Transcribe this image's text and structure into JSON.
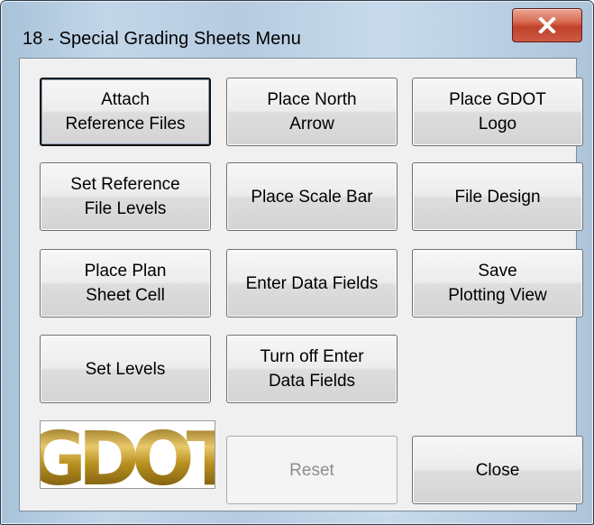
{
  "window": {
    "title": "18 - Special Grading Sheets Menu"
  },
  "title_bar": {
    "close_glyph": "X"
  },
  "menu_buttons": [
    {
      "label": "Attach\nReference Files"
    },
    {
      "label": "Place North\nArrow"
    },
    {
      "label": "Place GDOT\nLogo"
    },
    {
      "label": "Set Reference\nFile Levels"
    },
    {
      "label": "Place Scale Bar"
    },
    {
      "label": "File Design"
    },
    {
      "label": "Place Plan\nSheet Cell"
    },
    {
      "label": "Enter Data Fields"
    },
    {
      "label": "Save\nPlotting View"
    },
    {
      "label": "Set Levels"
    },
    {
      "label": "Turn off Enter\nData Fields"
    }
  ],
  "logo": {
    "text": "GDOT",
    "colors": {
      "gold_light": "#e9c86a",
      "gold_dark": "#7a5a10"
    }
  },
  "footer": {
    "reset_label": "Reset",
    "close_label": "Close"
  }
}
